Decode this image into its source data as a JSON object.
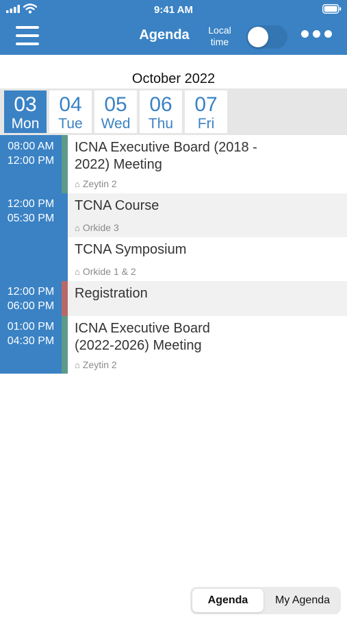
{
  "status_bar": {
    "time": "9:41 AM"
  },
  "header": {
    "title": "Agenda",
    "local_time_line1": "Local",
    "local_time_line2": "time"
  },
  "month_label": "October 2022",
  "days": [
    {
      "num": "03",
      "weekday": "Mon",
      "selected": true
    },
    {
      "num": "04",
      "weekday": "Tue",
      "selected": false
    },
    {
      "num": "05",
      "weekday": "Wed",
      "selected": false
    },
    {
      "num": "06",
      "weekday": "Thu",
      "selected": false
    },
    {
      "num": "07",
      "weekday": "Fri",
      "selected": false
    }
  ],
  "time_slots": [
    {
      "start": "08:00 AM",
      "end": "12:00 PM"
    },
    {
      "start": "12:00 PM",
      "end": "05:30 PM"
    },
    {
      "start": "12:00 PM",
      "end": "06:00 PM"
    },
    {
      "start": "01:00 PM",
      "end": "04:30 PM"
    }
  ],
  "events": [
    {
      "title_line1": "ICNA Executive Board (2018 -",
      "title_line2": "2022) Meeting",
      "location": "Zeytin 2",
      "color": "#5c9a8a"
    },
    {
      "title_line1": "TCNA Course",
      "location": "Orkide 3"
    },
    {
      "title_line1": "TCNA Symposium",
      "location": "Orkide 1 & 2"
    },
    {
      "title_line1": "Registration",
      "color": "#b86868"
    },
    {
      "title_line1": "ICNA Executive Board",
      "title_line2": "(2022-2026) Meeting",
      "location": "Zeytin 2",
      "color": "#5c9a8a"
    }
  ],
  "segmented": {
    "agenda": "Agenda",
    "my_agenda": "My Agenda",
    "selected": "Agenda"
  },
  "colors": {
    "primary": "#3a82c4",
    "row_alt": "#f1f1f1"
  },
  "icons": [
    "signal-icon",
    "wifi-icon",
    "battery-icon",
    "menu-icon",
    "more-icon",
    "location-icon"
  ]
}
